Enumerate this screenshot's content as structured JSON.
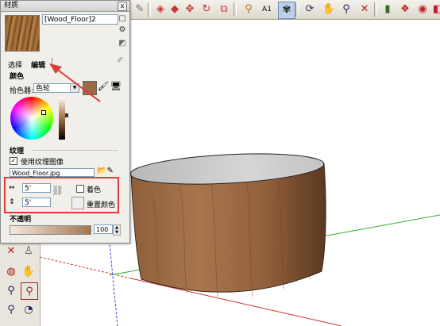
{
  "panel": {
    "title": "材质",
    "close_glyph": "x",
    "material_name": "[Wood_Floor]2",
    "tabs": [
      "选择",
      "编辑"
    ],
    "color_section": "颜色",
    "picker_label": "拾色器:",
    "picker_value": "色轮",
    "texture_section": "纹理",
    "use_texture_label": "使用纹理图像",
    "use_texture_checked": true,
    "texture_file": "Wood_Floor.jpg",
    "width_value": "5'",
    "height_value": "5'",
    "colorize_label": "着色",
    "reset_color_label": "重置颜色",
    "opacity_section": "不透明",
    "opacity_value": "100",
    "current_color": "#9b6a45"
  },
  "toolbar": {
    "icons": [
      "paint-bucket-icon",
      "eraser-icon",
      "move-icon",
      "rotate-icon",
      "scale-icon",
      "tape-measure-icon",
      "text-icon",
      "orbit-icon",
      "pan-icon",
      "zoom-icon",
      "zoom-extents-icon",
      "section-plane-icon",
      "components-icon",
      "styles-icon",
      "layers-icon",
      "shadows-icon"
    ]
  },
  "accent": {
    "annotation_red": "#e03a3a",
    "axis_red": "#d43030",
    "axis_green": "#2bb02b",
    "axis_blue": "#3a3ad0"
  }
}
